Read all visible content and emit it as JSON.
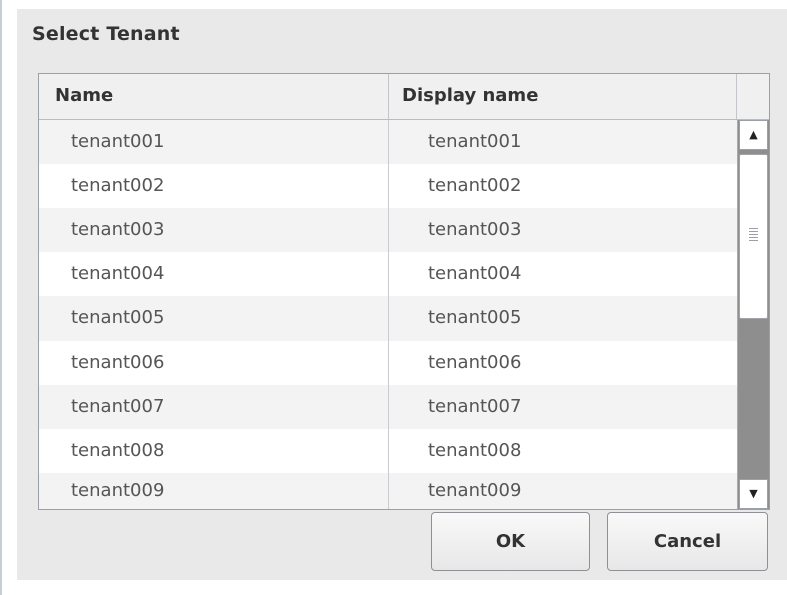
{
  "dialog": {
    "title": "Select Tenant"
  },
  "table": {
    "columns": [
      "Name",
      "Display name"
    ],
    "rows": [
      {
        "name": "tenant001",
        "display_name": "tenant001"
      },
      {
        "name": "tenant002",
        "display_name": "tenant002"
      },
      {
        "name": "tenant003",
        "display_name": "tenant003"
      },
      {
        "name": "tenant004",
        "display_name": "tenant004"
      },
      {
        "name": "tenant005",
        "display_name": "tenant005"
      },
      {
        "name": "tenant006",
        "display_name": "tenant006"
      },
      {
        "name": "tenant007",
        "display_name": "tenant007"
      },
      {
        "name": "tenant008",
        "display_name": "tenant008"
      },
      {
        "name": "tenant009",
        "display_name": "tenant009"
      }
    ]
  },
  "scrollbar": {
    "up_icon": "scroll-up-arrow",
    "down_icon": "scroll-down-arrow",
    "grip_icon": "scroll-grip"
  },
  "buttons": {
    "ok_label": "OK",
    "cancel_label": "Cancel"
  }
}
